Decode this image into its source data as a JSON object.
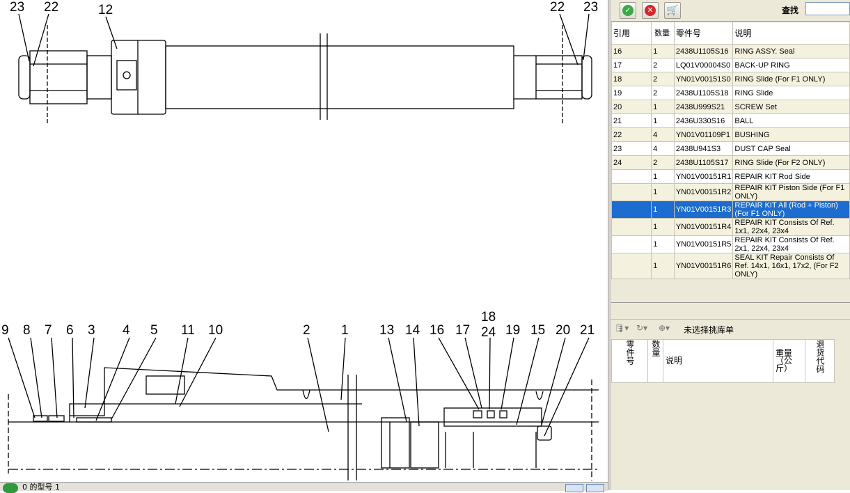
{
  "drawing": {
    "callouts_top": [
      {
        "label": "23"
      },
      {
        "label": "22"
      },
      {
        "label": "12"
      },
      {
        "label": "22"
      },
      {
        "label": "23"
      }
    ],
    "callouts_bottom": [
      {
        "label": "9"
      },
      {
        "label": "8"
      },
      {
        "label": "7"
      },
      {
        "label": "6"
      },
      {
        "label": "3"
      },
      {
        "label": "4"
      },
      {
        "label": "5"
      },
      {
        "label": "11"
      },
      {
        "label": "10"
      },
      {
        "label": "2"
      },
      {
        "label": "1"
      },
      {
        "label": "13"
      },
      {
        "label": "14"
      },
      {
        "label": "16"
      },
      {
        "label": "17"
      },
      {
        "label": "18"
      },
      {
        "label": "24"
      },
      {
        "label": "19"
      },
      {
        "label": "15"
      },
      {
        "label": "20"
      },
      {
        "label": "21"
      }
    ]
  },
  "statusbar": {
    "text": "0 的型号 1"
  },
  "toolbar": {
    "search_label": "查找",
    "search_value": ""
  },
  "parts_table": {
    "headers": {
      "ref": "引用",
      "qty": "数量",
      "part": "零件号",
      "desc": "说明"
    },
    "rows": [
      {
        "ref": "16",
        "qty": "1",
        "part": "2438U1105S16",
        "desc": "RING ASSY. Seal"
      },
      {
        "ref": "17",
        "qty": "2",
        "part": "LQ01V00004S0",
        "desc": "BACK-UP RING"
      },
      {
        "ref": "18",
        "qty": "2",
        "part": "YN01V00151S0",
        "desc": "RING Slide (For F1 ONLY)"
      },
      {
        "ref": "19",
        "qty": "2",
        "part": "2438U1105S18",
        "desc": "RING Slide"
      },
      {
        "ref": "20",
        "qty": "1",
        "part": "2438U999S21",
        "desc": "SCREW Set"
      },
      {
        "ref": "21",
        "qty": "1",
        "part": "2436U330S16",
        "desc": "BALL"
      },
      {
        "ref": "22",
        "qty": "4",
        "part": "YN01V01109P1",
        "desc": "BUSHING"
      },
      {
        "ref": "23",
        "qty": "4",
        "part": "2438U941S3",
        "desc": "DUST CAP Seal"
      },
      {
        "ref": "24",
        "qty": "2",
        "part": "2438U1105S17",
        "desc": "RING Slide (For F2 ONLY)"
      },
      {
        "ref": "",
        "qty": "1",
        "part": "YN01V00151R1",
        "desc": "REPAIR KIT Rod Side"
      },
      {
        "ref": "",
        "qty": "1",
        "part": "YN01V00151R2",
        "desc": "REPAIR KIT Piston Side (For F1 ONLY)"
      },
      {
        "ref": "",
        "qty": "1",
        "part": "YN01V00151R3",
        "desc": "REPAIR KIT All (Rod + Piston) (For F1 ONLY)"
      },
      {
        "ref": "",
        "qty": "1",
        "part": "YN01V00151R4",
        "desc": "REPAIR KIT Consists Of Ref. 1x1, 22x4,  23x4"
      },
      {
        "ref": "",
        "qty": "1",
        "part": "YN01V00151R5",
        "desc": "REPAIR KIT Consists Of Ref. 2x1, 22x4, 23x4"
      },
      {
        "ref": "",
        "qty": "1",
        "part": "YN01V00151R6",
        "desc": "SEAL KIT Repair Consists Of Ref. 14x1, 16x1, 17x2, (For F2 ONLY)"
      }
    ],
    "selected_row": 11
  },
  "picklist": {
    "label": "未选择挑库单",
    "headers": {
      "part": "零件号",
      "qty": "数量",
      "desc": "说明",
      "weight": "重量（公斤）",
      "code": "退货代码"
    }
  },
  "colors": {
    "selection": "#1d6ccf",
    "row_alt": "#f4f2df",
    "panel": "#ece9d8"
  }
}
